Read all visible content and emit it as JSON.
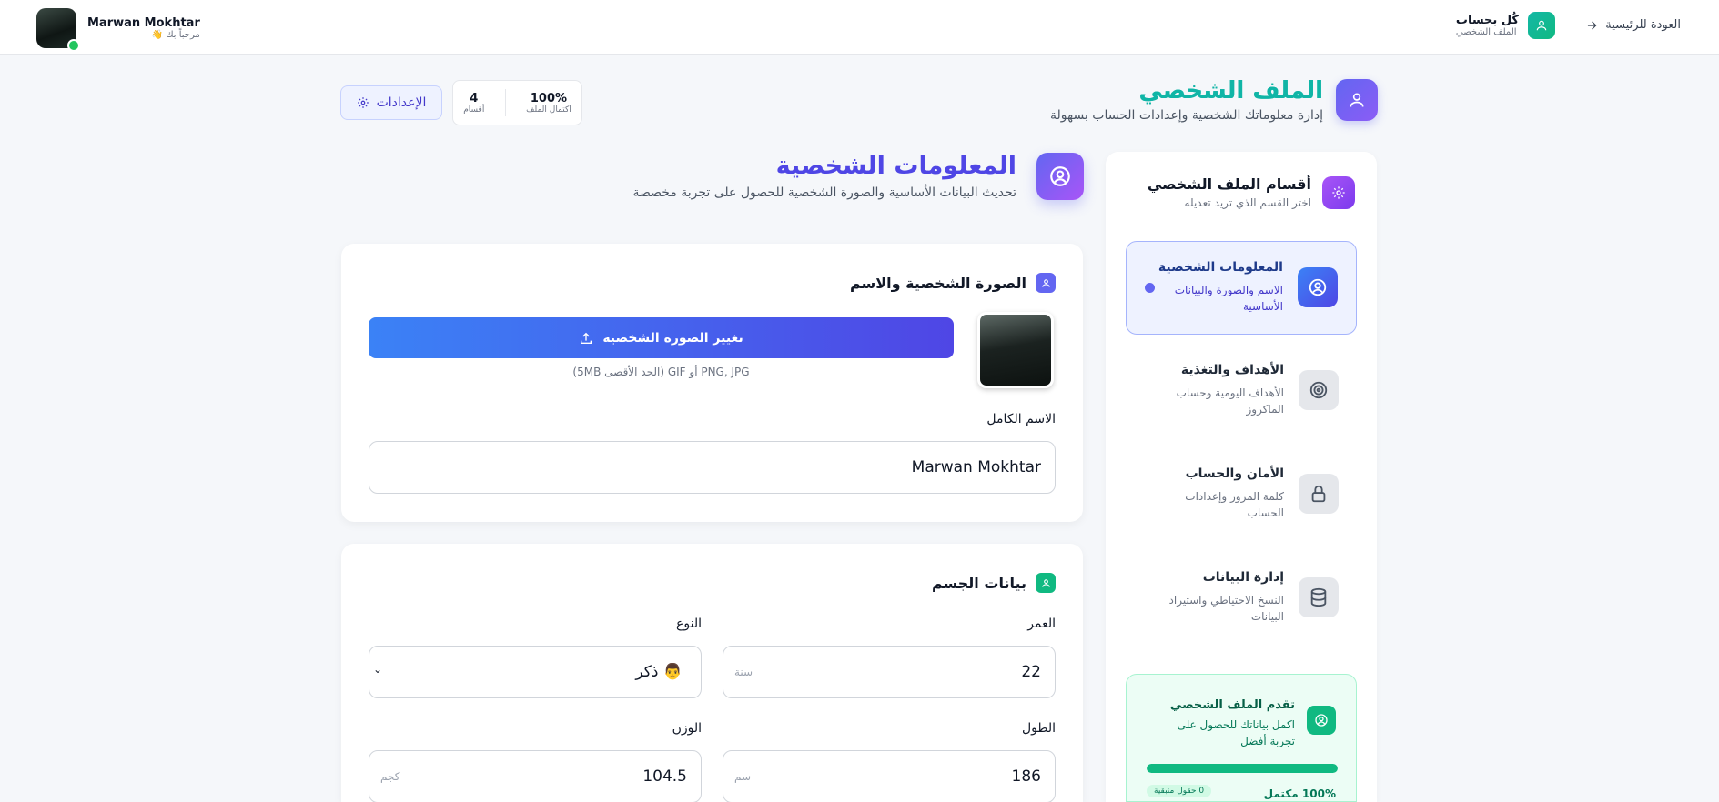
{
  "topbar": {
    "back_label": "العودة للرئيسية",
    "brand_title": "كُل بحساب",
    "brand_sub": "الملف الشخصي",
    "user_name": "Marwan Mokhtar",
    "user_greet": "مرحباً بك 👋"
  },
  "page": {
    "title": "الملف الشخصي",
    "subtitle": "إدارة معلوماتك الشخصية وإعدادات الحساب بسهولة"
  },
  "stats": {
    "completion_value": "100%",
    "completion_label": "اكتمال الملف",
    "sections_value": "4",
    "sections_label": "أقسام"
  },
  "settings_label": "الإعدادات",
  "sidebar": {
    "title": "أقسام الملف الشخصي",
    "subtitle": "اختر القسم الذي تريد تعديله",
    "items": [
      {
        "title": "المعلومات الشخصية",
        "desc": "الاسم والصورة والبيانات الأساسية"
      },
      {
        "title": "الأهداف والتغذية",
        "desc": "الأهداف اليومية وحساب الماكروز"
      },
      {
        "title": "الأمان والحساب",
        "desc": "كلمة المرور وإعدادات الحساب"
      },
      {
        "title": "إدارة البيانات",
        "desc": "النسخ الاحتياطي واستيراد البيانات"
      }
    ],
    "progress": {
      "title": "تقدم الملف الشخصي",
      "desc": "اكمل بياناتك للحصول على تجربة أفضل",
      "value": 100,
      "percent_label": "100% مكتمل",
      "remaining_label": "0 حقول متبقية"
    }
  },
  "section": {
    "title": "المعلومات الشخصية",
    "subtitle": "تحديث البيانات الأساسية والصورة الشخصية للحصول على تجربة مخصصة"
  },
  "photo_card": {
    "title": "الصورة الشخصية والاسم",
    "upload_label": "تغيير الصورة الشخصية",
    "upload_hint": "PNG, JPG أو GIF (الحد الأقصى 5MB)",
    "name_label": "الاسم الكامل",
    "name_value": "Marwan Mokhtar"
  },
  "body_card": {
    "title": "بيانات الجسم",
    "age_label": "العمر",
    "age_value": "22",
    "age_unit": "سنة",
    "gender_label": "النوع",
    "gender_value": "👨 ذكر",
    "height_label": "الطول",
    "height_value": "186",
    "height_unit": "سم",
    "weight_label": "الوزن",
    "weight_value": "104.5",
    "weight_unit": "كجم"
  },
  "colors": {
    "primary": "#4f46e5",
    "teal": "#14b8a6",
    "success": "#10b981"
  }
}
